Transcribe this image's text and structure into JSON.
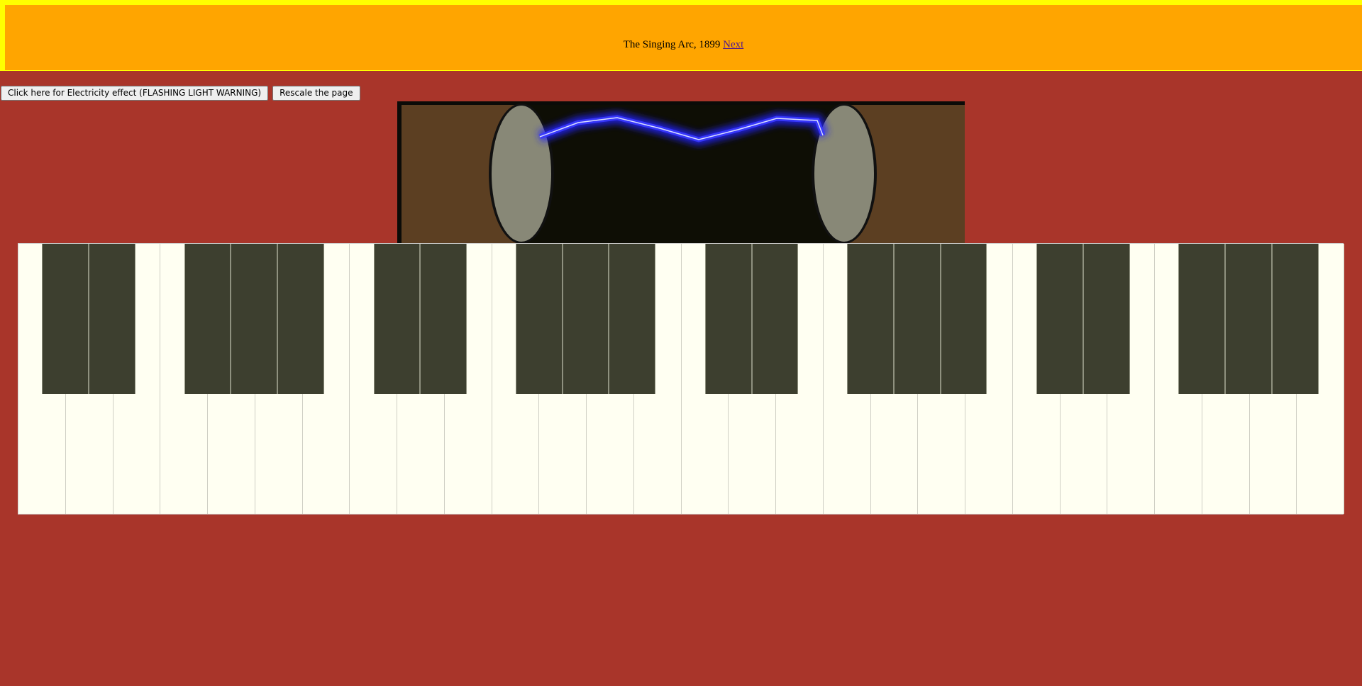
{
  "header": {
    "title": "The Singing Arc, 1899",
    "next_link": "Next"
  },
  "controls": {
    "electricity_button": "Click here for Electricity effect (FLASHING LIGHT WARNING)",
    "rescale_button": "Rescale the page"
  },
  "colors": {
    "page_background": "#a9352a",
    "banner_border": "#ffff00",
    "banner_fill": "#ffa500",
    "white_key": "#fffff2",
    "black_key": "#3d3f2f",
    "arc_glow": "#2222ff",
    "electrode": "#888877",
    "arc_housing": "#5c3f22"
  },
  "keyboard": {
    "white_key_count": 28,
    "black_key_pattern": [
      2,
      3,
      2,
      3,
      2,
      3,
      2,
      3
    ]
  }
}
